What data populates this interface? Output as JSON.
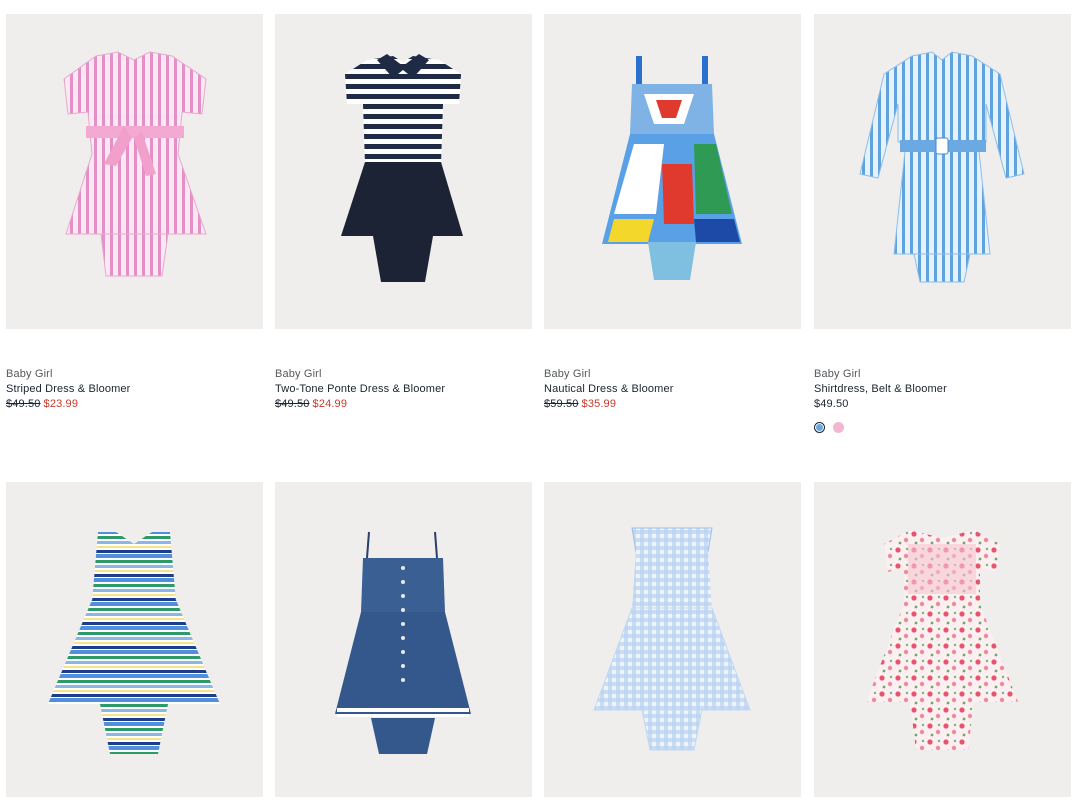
{
  "products": [
    {
      "category": "Baby Girl",
      "name": "Striped Dress & Bloomer",
      "orig_price": "$49.50",
      "sale_price": "$23.99"
    },
    {
      "category": "Baby Girl",
      "name": "Two-Tone Ponte Dress & Bloomer",
      "orig_price": "$49.50",
      "sale_price": "$24.99"
    },
    {
      "category": "Baby Girl",
      "name": "Nautical Dress & Bloomer",
      "orig_price": "$59.50",
      "sale_price": "$35.99"
    },
    {
      "category": "Baby Girl",
      "name": "Shirtdress, Belt & Bloomer",
      "price": "$49.50",
      "swatches": [
        {
          "color": "#6aa6e0",
          "selected": true
        },
        {
          "color": "#f2b8d2",
          "selected": false
        }
      ]
    },
    {},
    {},
    {},
    {}
  ],
  "colors": {
    "sale": "#c8392b",
    "tile_bg": "#efeeed",
    "text": "#1b2431"
  }
}
